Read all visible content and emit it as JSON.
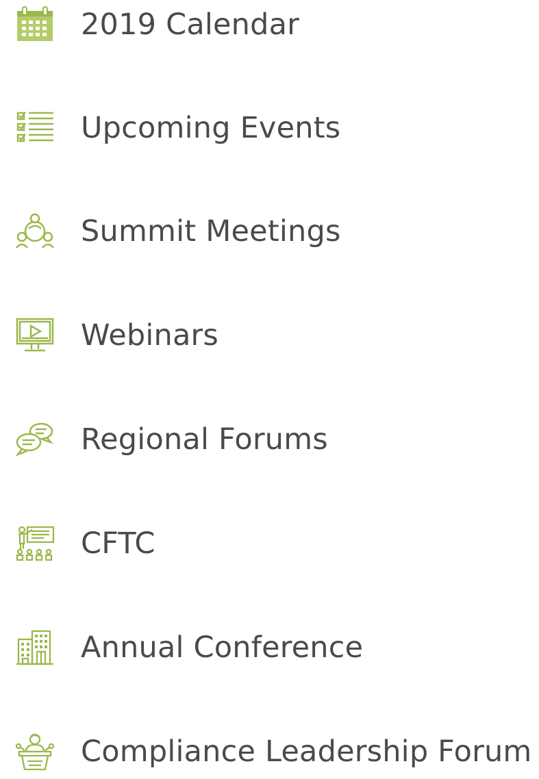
{
  "colors": {
    "icon": "#9bb84a",
    "text": "#4a4a4d",
    "background": "#ffffff"
  },
  "menu": {
    "items": [
      {
        "label": "2019 Calendar",
        "icon": "calendar-icon"
      },
      {
        "label": "Upcoming Events",
        "icon": "checklist-icon"
      },
      {
        "label": "Summit Meetings",
        "icon": "group-meeting-icon"
      },
      {
        "label": "Webinars",
        "icon": "monitor-play-icon"
      },
      {
        "label": "Regional Forums",
        "icon": "chat-bubbles-icon"
      },
      {
        "label": "CFTC",
        "icon": "presentation-icon"
      },
      {
        "label": "Annual Conference",
        "icon": "buildings-icon"
      },
      {
        "label": "Compliance Leadership Forum",
        "icon": "speaker-podium-icon"
      }
    ]
  }
}
